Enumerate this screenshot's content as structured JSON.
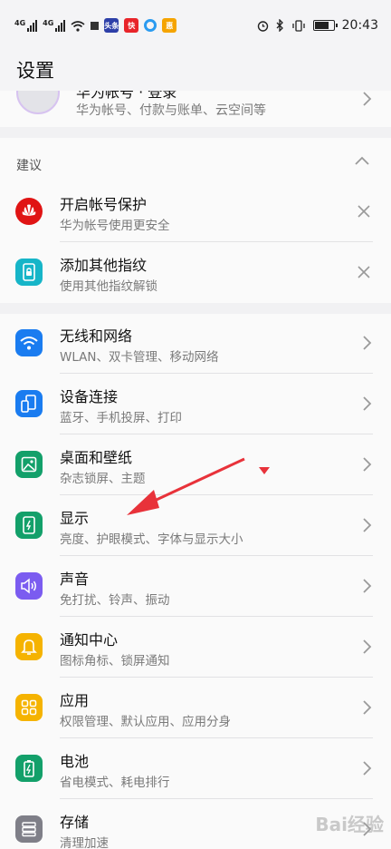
{
  "status_bar": {
    "sig1": "4G",
    "sig2": "4G",
    "app1": "头条",
    "app2": "快",
    "app3": "惠",
    "time": "20:43"
  },
  "header": {
    "title": "设置"
  },
  "account": {
    "title": "华为帐号 · 登录",
    "subtitle": "华为帐号、付款与账单、云空间等"
  },
  "suggestions": {
    "label": "建议",
    "items": [
      {
        "title": "开启帐号保护",
        "subtitle": "华为帐号使用更安全",
        "icon": "huawei-logo-icon",
        "color": "#e01414"
      },
      {
        "title": "添加其他指纹",
        "subtitle": "使用其他指纹解锁",
        "icon": "fingerprint-lock-icon",
        "color": "#16b5c8"
      }
    ]
  },
  "settings": {
    "items": [
      {
        "title": "无线和网络",
        "subtitle": "WLAN、双卡管理、移动网络",
        "icon": "wifi-icon",
        "color": "#1a7cf0"
      },
      {
        "title": "设备连接",
        "subtitle": "蓝牙、手机投屏、打印",
        "icon": "device-connect-icon",
        "color": "#1a7cf0"
      },
      {
        "title": "桌面和壁纸",
        "subtitle": "杂志锁屏、主题",
        "icon": "wallpaper-icon",
        "color": "#13a06a"
      },
      {
        "title": "显示",
        "subtitle": "亮度、护眼模式、字体与显示大小",
        "icon": "display-icon",
        "color": "#13a06a"
      },
      {
        "title": "声音",
        "subtitle": "免打扰、铃声、振动",
        "icon": "speaker-icon",
        "color": "#7b5cf0"
      },
      {
        "title": "通知中心",
        "subtitle": "图标角标、锁屏通知",
        "icon": "bell-icon",
        "color": "#f5b300"
      },
      {
        "title": "应用",
        "subtitle": "权限管理、默认应用、应用分身",
        "icon": "apps-grid-icon",
        "color": "#f5b300"
      },
      {
        "title": "电池",
        "subtitle": "省电模式、耗电排行",
        "icon": "battery-icon",
        "color": "#13a06a"
      },
      {
        "title": "存储",
        "subtitle": "清理加速",
        "icon": "storage-icon",
        "color": "#7f7f88"
      }
    ]
  },
  "watermark": "Bai经验"
}
